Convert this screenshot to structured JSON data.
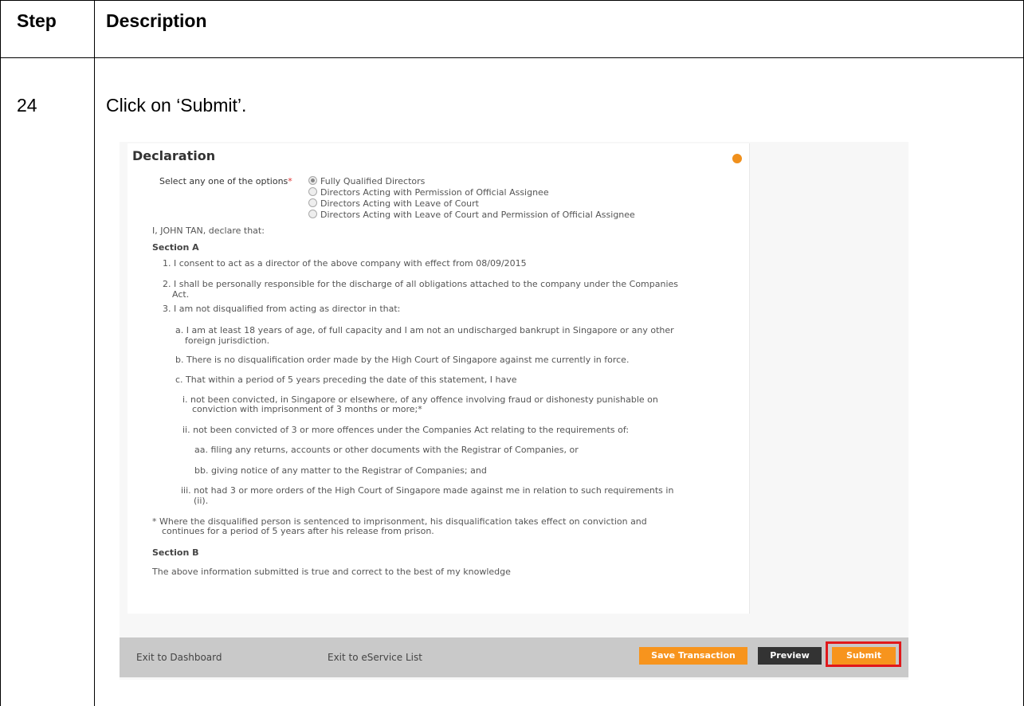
{
  "table": {
    "header_step": "Step",
    "header_description": "Description",
    "step_number": "24",
    "instruction": "Click on ‘Submit’."
  },
  "screenshot": {
    "title": "Declaration",
    "select_label": "Select any one of the options",
    "required_mark": "*",
    "options": [
      {
        "label": "Fully Qualified Directors",
        "selected": true
      },
      {
        "label": "Directors Acting with Permission of Official Assignee",
        "selected": false
      },
      {
        "label": "Directors Acting with Leave of Court",
        "selected": false
      },
      {
        "label": "Directors Acting with Leave of Court and Permission of Official Assignee",
        "selected": false
      }
    ],
    "declare_intro": "I, JOHN TAN, declare that:",
    "section_a": "Section A",
    "item1": "1. I consent to act as a director of the above company with effect from  08/09/2015",
    "item2a": "2. I shall be personally responsible for the discharge of all obligations attached to the company under the Companies",
    "item2b": "Act.",
    "item3": "3. I am not disqualified from acting as director in that:",
    "item3a1": "a. I am at least 18 years of age, of full capacity and I am not an undischarged bankrupt in Singapore or any other",
    "item3a2": "foreign jurisdiction.",
    "item3b": "b. There is no disqualification order made by the High Court of Singapore against me currently in force.",
    "item3c": "c. That within a period of 5 years preceding the date of this statement, I have",
    "item_i1": "i. not been convicted, in Singapore or elsewhere, of any offence involving fraud or dishonesty punishable on",
    "item_i2": "conviction with imprisonment of 3 months or more;*",
    "item_ii": "ii. not been convicted of 3 or more offences under the Companies Act relating to the requirements of:",
    "item_aa": "aa. filing any returns, accounts or other documents with the Registrar of Companies, or",
    "item_bb": "bb. giving notice of any matter to the Registrar of Companies; and",
    "item_iii1": "iii. not had 3 or more orders of the High Court of Singapore made against me in relation to such requirements in",
    "item_iii2": "(ii).",
    "footnote1": "* Where the disqualified person is sentenced to imprisonment, his disqualification takes effect on conviction and",
    "footnote2": "continues for a period of 5 years after his release from prison.",
    "section_b": "Section B",
    "section_b_text": "The above information submitted is true and correct to the best of my knowledge",
    "footer": {
      "exit_dashboard": "Exit to Dashboard",
      "exit_eservice": "Exit to eService List",
      "save_transaction": "Save Transaction",
      "preview": "Preview",
      "submit": "Submit"
    }
  }
}
